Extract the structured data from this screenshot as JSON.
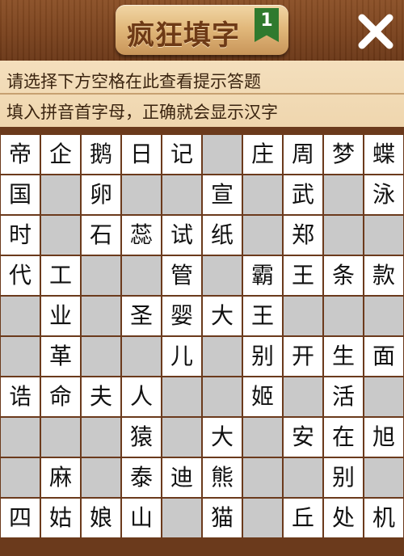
{
  "header": {
    "title": "疯狂填字",
    "level": "1",
    "close_icon": "close-x-icon"
  },
  "hints": {
    "line1": "请选择下方空格在此查看提示答题",
    "line2": "填入拼音首字母，正确就会显示汉字"
  },
  "colors": {
    "wood": "#7a421d",
    "hint_bg": "#f0d8b2",
    "white_cell": "#ffffff",
    "gray_cell": "#c9c9c9",
    "flag": "#2f7a2e"
  },
  "grid": {
    "rows": 10,
    "cols": 10,
    "cells": [
      [
        "帝",
        "企",
        "鹅",
        "日",
        "记",
        "",
        "庄",
        "周",
        "梦",
        "蝶"
      ],
      [
        "国",
        "",
        "卵",
        "",
        "",
        "宣",
        "",
        "武",
        "",
        "泳"
      ],
      [
        "时",
        "",
        "石",
        "蕊",
        "试",
        "纸",
        "",
        "郑",
        "",
        ""
      ],
      [
        "代",
        "工",
        "",
        "",
        "管",
        "",
        "霸",
        "王",
        "条",
        "款"
      ],
      [
        "",
        "业",
        "",
        "圣",
        "婴",
        "大",
        "王",
        "",
        "",
        ""
      ],
      [
        "",
        "革",
        "",
        "",
        "儿",
        "",
        "别",
        "开",
        "生",
        "面"
      ],
      [
        "诰",
        "命",
        "夫",
        "人",
        "",
        "",
        "姬",
        "",
        "活",
        ""
      ],
      [
        "",
        "",
        "",
        "猿",
        "",
        "大",
        "",
        "安",
        "在",
        "旭"
      ],
      [
        "",
        "麻",
        "",
        "泰",
        "迪",
        "熊",
        "",
        "",
        "别",
        ""
      ],
      [
        "四",
        "姑",
        "娘",
        "山",
        "",
        "猫",
        "",
        "丘",
        "处",
        "机"
      ]
    ],
    "blocked": [
      [
        0,
        0,
        0,
        0,
        0,
        1,
        0,
        0,
        0,
        0
      ],
      [
        0,
        1,
        0,
        1,
        1,
        0,
        1,
        0,
        1,
        0
      ],
      [
        0,
        1,
        0,
        0,
        0,
        0,
        1,
        0,
        1,
        1
      ],
      [
        0,
        0,
        1,
        1,
        0,
        1,
        0,
        0,
        0,
        0
      ],
      [
        1,
        0,
        1,
        0,
        0,
        0,
        0,
        1,
        1,
        1
      ],
      [
        1,
        0,
        1,
        1,
        0,
        1,
        0,
        0,
        0,
        0
      ],
      [
        0,
        0,
        0,
        0,
        1,
        1,
        0,
        1,
        0,
        1
      ],
      [
        1,
        1,
        1,
        0,
        1,
        0,
        1,
        0,
        0,
        0
      ],
      [
        1,
        0,
        1,
        0,
        0,
        0,
        1,
        1,
        0,
        1
      ],
      [
        0,
        0,
        0,
        0,
        1,
        0,
        1,
        0,
        0,
        0
      ]
    ]
  }
}
